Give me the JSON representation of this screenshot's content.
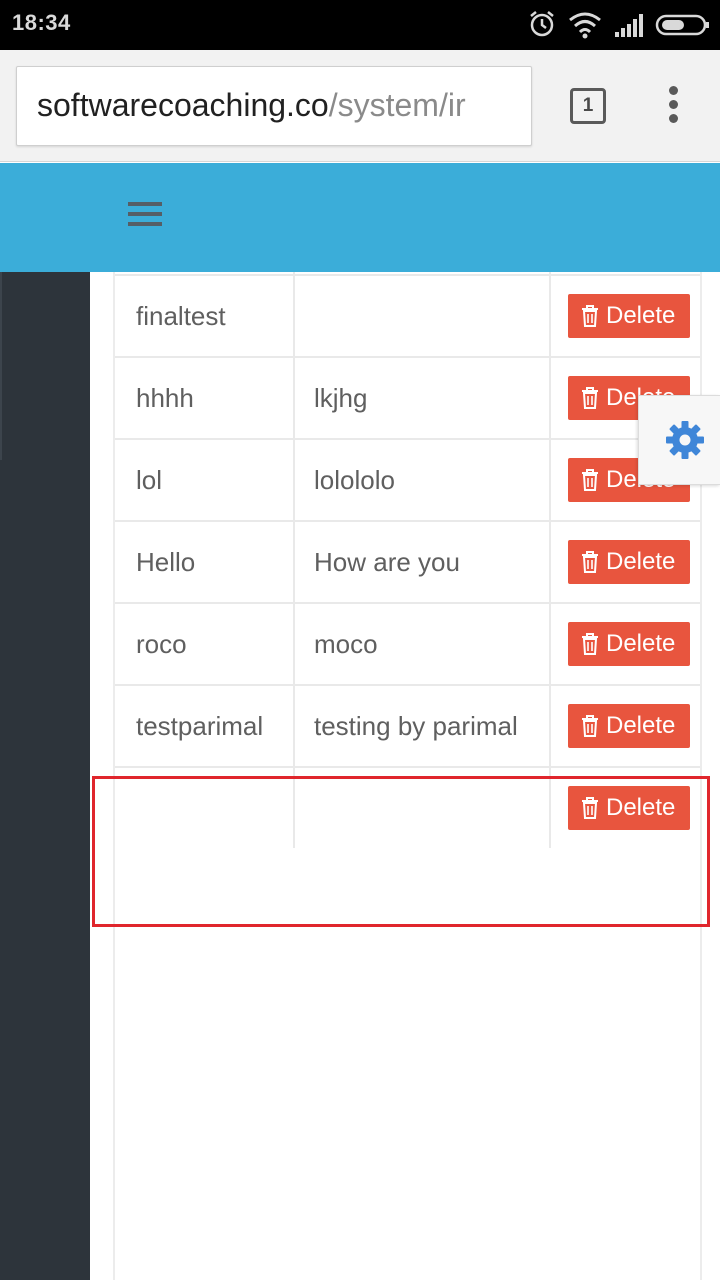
{
  "status_bar": {
    "time": "18:34",
    "icons": [
      "alarm-icon",
      "wifi-icon",
      "signal-icon",
      "battery-icon"
    ]
  },
  "browser": {
    "url_host": "softwarecoaching.co",
    "url_path": "/system/ir",
    "tab_count": "1",
    "icons": [
      "tabs-icon",
      "overflow-menu-icon"
    ]
  },
  "app_header": {
    "background_color": "#3badd9",
    "menu_icon": "hamburger-menu-icon"
  },
  "table": {
    "rows": [
      {
        "col1": "finaltest",
        "col2": "",
        "action": "Delete"
      },
      {
        "col1": "hhhh",
        "col2": "lkjhg",
        "action": "Delete"
      },
      {
        "col1": "lol",
        "col2": "lolololo",
        "action": "Delete"
      },
      {
        "col1": "Hello",
        "col2": "How are you",
        "action": "Delete"
      },
      {
        "col1": "roco",
        "col2": "moco",
        "action": "Delete"
      },
      {
        "col1": "testparimal",
        "col2": "testing by parimal",
        "action": "Delete"
      },
      {
        "col1": "",
        "col2": "",
        "action": "Delete"
      }
    ],
    "delete_button_color": "#e8553e",
    "delete_icon": "trash-icon"
  },
  "settings_widget": {
    "icon": "gear-icon",
    "color": "#3f86d8"
  },
  "annotation": {
    "highlight_color": "#e0262c"
  }
}
